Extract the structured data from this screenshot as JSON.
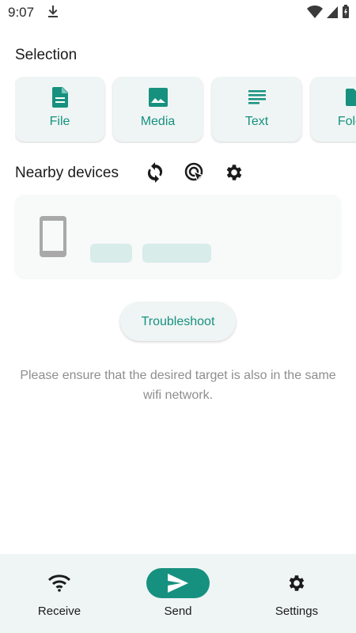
{
  "status_bar": {
    "time": "9:07"
  },
  "selection": {
    "title": "Selection",
    "items": [
      {
        "label": "File",
        "icon": "file-icon"
      },
      {
        "label": "Media",
        "icon": "image-icon"
      },
      {
        "label": "Text",
        "icon": "text-icon"
      },
      {
        "label": "Folder",
        "icon": "folder-icon"
      }
    ]
  },
  "nearby": {
    "title": "Nearby devices"
  },
  "troubleshoot_label": "Troubleshoot",
  "hint": "Please ensure that the desired target is also in the same wifi network.",
  "bottom_nav": {
    "items": [
      {
        "label": "Receive",
        "icon": "wifi-icon"
      },
      {
        "label": "Send",
        "icon": "send-icon"
      },
      {
        "label": "Settings",
        "icon": "gear-icon"
      }
    ]
  },
  "colors": {
    "accent": "#17917F",
    "card_bg": "#EFF5F4",
    "placeholder": "#D8ECEA",
    "nav_bg": "#EEF5F4"
  }
}
